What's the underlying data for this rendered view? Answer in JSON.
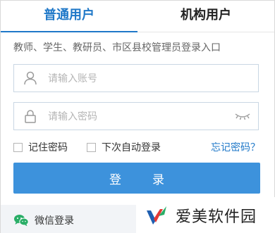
{
  "tabs": [
    {
      "label": "普通用户",
      "active": true
    },
    {
      "label": "机构用户",
      "active": false
    }
  ],
  "hint": "教师、学生、教研员、市区县校管理员登录入口",
  "account": {
    "placeholder": "请输入账号",
    "value": "",
    "icon": "user-icon"
  },
  "password": {
    "placeholder": "请输入密码",
    "value": "",
    "icon": "lock-icon",
    "toggle_icon": "eye-closed-icon"
  },
  "options": {
    "remember_label": "记住密码",
    "remember_checked": false,
    "autologin_label": "下次自动登录",
    "autologin_checked": false,
    "forgot_label": "忘记密码？"
  },
  "login_button": "登录",
  "footer": {
    "wechat_label": "微信登录",
    "icon": "wechat-icon"
  },
  "watermark": {
    "text": "爱美软件园"
  },
  "colors": {
    "accent": "#1f78c8",
    "button": "#3d92dc",
    "footer_bg": "#f2f4f7",
    "wechat_green": "#2aae67"
  }
}
